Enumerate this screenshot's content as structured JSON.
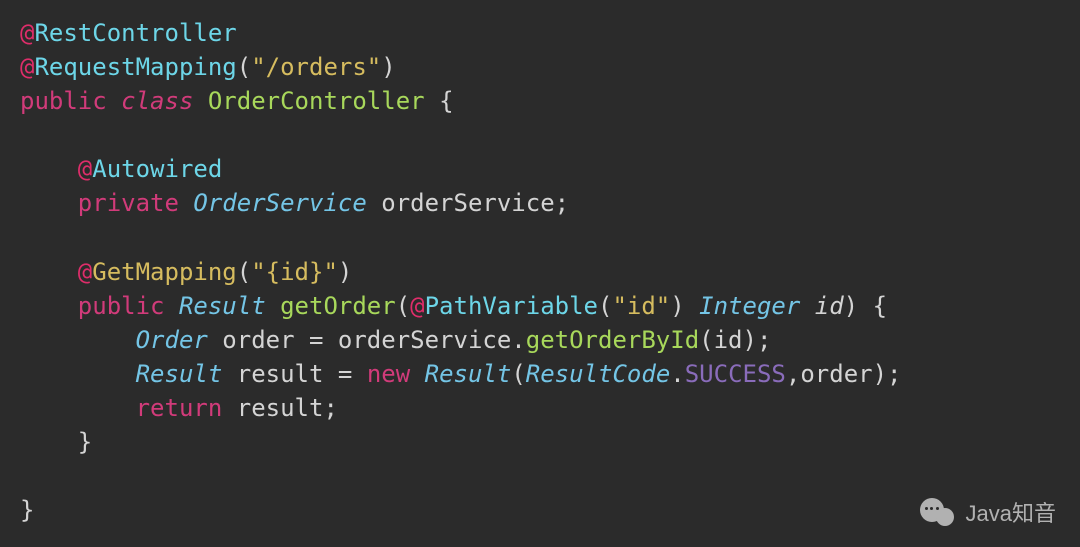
{
  "code": {
    "ann1_at": "@",
    "ann1_name": "RestController",
    "ann2_at": "@",
    "ann2_name": "RequestMapping",
    "ann2_paren_open": "(",
    "ann2_arg": "\"/orders\"",
    "ann2_paren_close": ")",
    "kw_public1": "public",
    "kw_class": "class",
    "class_name": "OrderController",
    "brace_open1": "{",
    "ann3_at": "@",
    "ann3_name": "Autowired",
    "kw_private": "private",
    "type_service": "OrderService",
    "field_service": "orderService",
    "semi": ";",
    "ann4_at": "@",
    "ann4_name": "GetMapping",
    "ann4_paren_open": "(",
    "ann4_arg": "\"{id}\"",
    "ann4_paren_close": ")",
    "kw_public2": "public",
    "type_result": "Result",
    "method_name": "getOrder",
    "paren_open": "(",
    "ann5_at": "@",
    "ann5_name": "PathVariable",
    "ann5_paren_open": "(",
    "ann5_arg": "\"id\"",
    "ann5_paren_close": ")",
    "type_integer": "Integer",
    "param_id": "id",
    "paren_close": ")",
    "brace_open2": "{",
    "type_order": "Order",
    "var_order": "order",
    "eq": "=",
    "call_service": "orderService",
    "dot": ".",
    "call_method1": "getOrderById",
    "call_arg1": "id",
    "type_result2": "Result",
    "var_result": "result",
    "kw_new": "new",
    "ctor_result": "Result",
    "enum_class": "ResultCode",
    "enum_val": "SUCCESS",
    "comma": ",",
    "arg_order": "order",
    "kw_return": "return",
    "ret_val": "result",
    "brace_close2": "}",
    "brace_close1": "}"
  },
  "watermark": {
    "text": "Java知音"
  }
}
